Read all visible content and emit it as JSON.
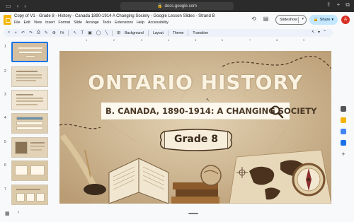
{
  "browser": {
    "url": "docs.google.com"
  },
  "header": {
    "title": "Copy of V1 - Grade 8 - History - Canada 1890-1914 A Changing Society - Google Lesson Slides - Strand B",
    "menu": [
      "File",
      "Edit",
      "View",
      "Insert",
      "Format",
      "Slide",
      "Arrange",
      "Tools",
      "Extensions",
      "Help",
      "Accessibility"
    ],
    "slideshow_label": "Slideshow",
    "share_label": "Share",
    "avatar_letter": "A"
  },
  "toolbar": {
    "zoom_label": "Fit",
    "background_label": "Background",
    "layout_label": "Layout",
    "theme_label": "Theme",
    "transition_label": "Transition"
  },
  "filmstrip": {
    "slide_numbers": [
      "1",
      "2",
      "3",
      "4",
      "5",
      "6",
      "7"
    ]
  },
  "ruler": {
    "ticks": [
      "1",
      "2",
      "3",
      "4",
      "5",
      "6",
      "7",
      "8",
      "9"
    ]
  },
  "slide": {
    "title": "ONTARIO HISTORY",
    "subtitle": "B. CANADA, 1890-1914: A CHANGING SOCIETY",
    "grade_label": "Grade 8"
  },
  "colors": {
    "accent_blue": "#1a73e8",
    "share_bg": "#c2e7ff",
    "avatar_bg": "#d93025",
    "slide_paper": "#d8c4a4"
  }
}
